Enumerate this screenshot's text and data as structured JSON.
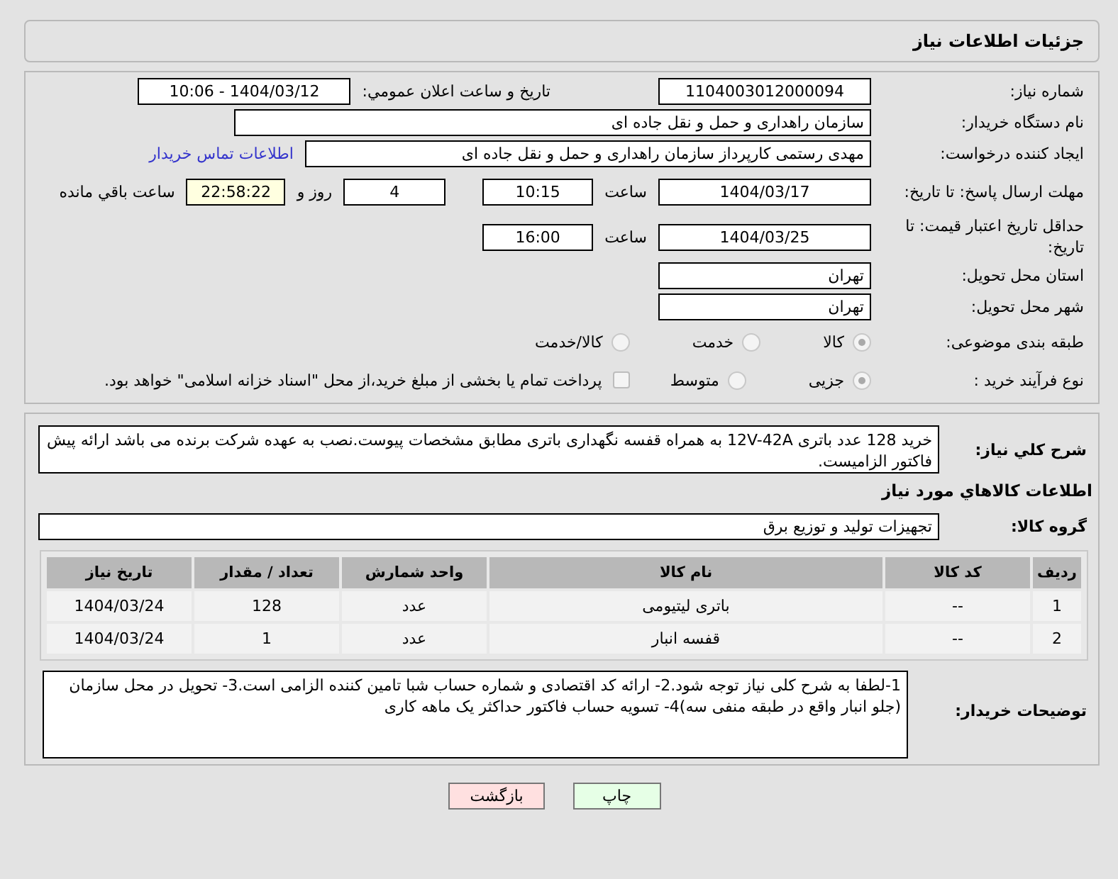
{
  "header": {
    "title": "جزئیات اطلاعات نیاز"
  },
  "need_number": {
    "label": "شماره نیاز:",
    "value": "1104003012000094"
  },
  "announce": {
    "label": "تاریخ و ساعت اعلان عمومي:",
    "value": "1404/03/12 - 10:06"
  },
  "buyer_org": {
    "label": "نام دستگاه خریدار:",
    "value": "سازمان راهداری و حمل و نقل جاده ای"
  },
  "requester": {
    "label": "ایجاد کننده درخواست:",
    "value": "مهدی رستمی کارپرداز سازمان راهداری و حمل و نقل جاده ای",
    "link": "اطلاعات تماس خریدار"
  },
  "reply_deadline": {
    "label": "مهلت ارسال پاسخ: تا تاریخ:",
    "date": "1404/03/17",
    "time_label": "ساعت",
    "time": "10:15",
    "days": "4",
    "days_label": "روز و",
    "remaining": "22:58:22",
    "remaining_label": "ساعت باقي مانده"
  },
  "price_validity": {
    "label": "حداقل تاریخ اعتبار قیمت: تا تاریخ:",
    "date": "1404/03/25",
    "time_label": "ساعت",
    "time": "16:00"
  },
  "province": {
    "label": "استان محل تحویل:",
    "value": "تهران"
  },
  "city": {
    "label": "شهر محل تحویل:",
    "value": "تهران"
  },
  "category": {
    "label": "طبقه بندی موضوعی:",
    "options": [
      {
        "label": "کالا",
        "selected": true
      },
      {
        "label": "خدمت",
        "selected": false
      },
      {
        "label": "کالا/خدمت",
        "selected": false
      }
    ]
  },
  "purchase_type": {
    "label": "نوع فرآیند خرید :",
    "options": [
      {
        "label": "جزیی",
        "selected": true
      },
      {
        "label": "متوسط",
        "selected": false
      }
    ],
    "payment": {
      "checked": false,
      "text": "پرداخت تمام یا بخشی از مبلغ خرید،از محل \"اسناد خزانه اسلامی\" خواهد بود."
    }
  },
  "description": {
    "label": "شرح کلي نياز:",
    "value": "خرید 128 عدد باتری 12V-42A به همراه قفسه نگهداری باتری مطابق مشخصات پیوست.نصب به عهده شرکت برنده می باشد ارائه پیش فاکتور الزامیست."
  },
  "goods_title": "اطلاعات کالاهاي مورد نياز",
  "goods_group": {
    "label": "گروه کالا:",
    "value": "تجهیزات تولید و توزیع برق"
  },
  "table": {
    "columns": [
      "ردیف",
      "کد کالا",
      "نام کالا",
      "واحد شمارش",
      "تعداد / مقدار",
      "تاریخ نیاز"
    ],
    "rows": [
      [
        "1",
        "--",
        "باتری لیتیومی",
        "عدد",
        "128",
        "1404/03/24"
      ],
      [
        "2",
        "--",
        "قفسه انبار",
        "عدد",
        "1",
        "1404/03/24"
      ]
    ]
  },
  "buyer_notes": {
    "label": "توضیحات خریدار:",
    "value": "1-لطفا به شرح کلی نیاز توجه شود.2- ارائه کد اقتصادی و شماره حساب شبا تامین کننده الزامی است.3- تحویل در محل سازمان (جلو انبار واقع در طبقه منفی سه)4- تسویه حساب فاکتور حداکثر یک ماهه کاری"
  },
  "buttons": [
    {
      "label": "چاپ",
      "kind": "print"
    },
    {
      "label": "بازگشت",
      "kind": "back"
    }
  ]
}
